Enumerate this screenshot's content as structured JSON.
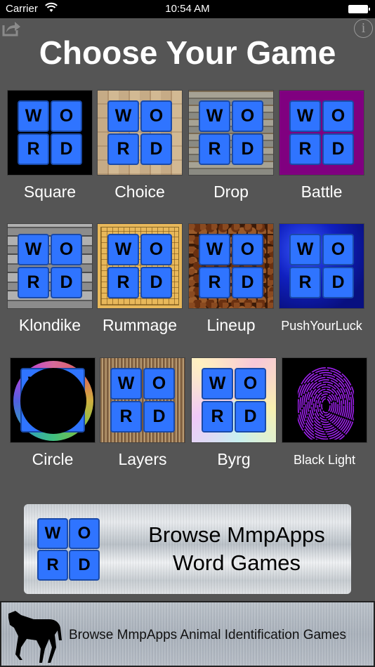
{
  "status_bar": {
    "carrier": "Carrier",
    "time": "10:54 AM"
  },
  "toolbar": {
    "share_icon": "share-icon",
    "info_icon": "info-icon",
    "info_glyph": "i"
  },
  "title": "Choose Your Game",
  "word_tile_letters": [
    "W",
    "O",
    "R",
    "D"
  ],
  "games": [
    {
      "label": "Square",
      "background": "#000000"
    },
    {
      "label": "Choice",
      "background": "wood-butcher-block"
    },
    {
      "label": "Drop",
      "background": "stone-wall"
    },
    {
      "label": "Battle",
      "background": "#800080"
    },
    {
      "label": "Klondike",
      "background": "weathered-wood"
    },
    {
      "label": "Rummage",
      "background": "go-board"
    },
    {
      "label": "Lineup",
      "background": "coffee-beans"
    },
    {
      "label": "PushYourLuck",
      "background": "blue-silk"
    },
    {
      "label": "Circle",
      "background": "color-wheel"
    },
    {
      "label": "Layers",
      "background": "straw"
    },
    {
      "label": "Byrg",
      "background": "pastel-swirl"
    },
    {
      "label": "Black Light",
      "background": "purple-fingerprint"
    }
  ],
  "browse_word_games": {
    "line1": "Browse MmpApps",
    "line2": "Word Games"
  },
  "browse_animal_games": {
    "label": "Browse MmpApps Animal Identification Games",
    "icon": "horse-icon"
  },
  "colors": {
    "background": "#555555",
    "tile_blue": "#2f74ff",
    "tile_border": "#1a4aa8"
  }
}
